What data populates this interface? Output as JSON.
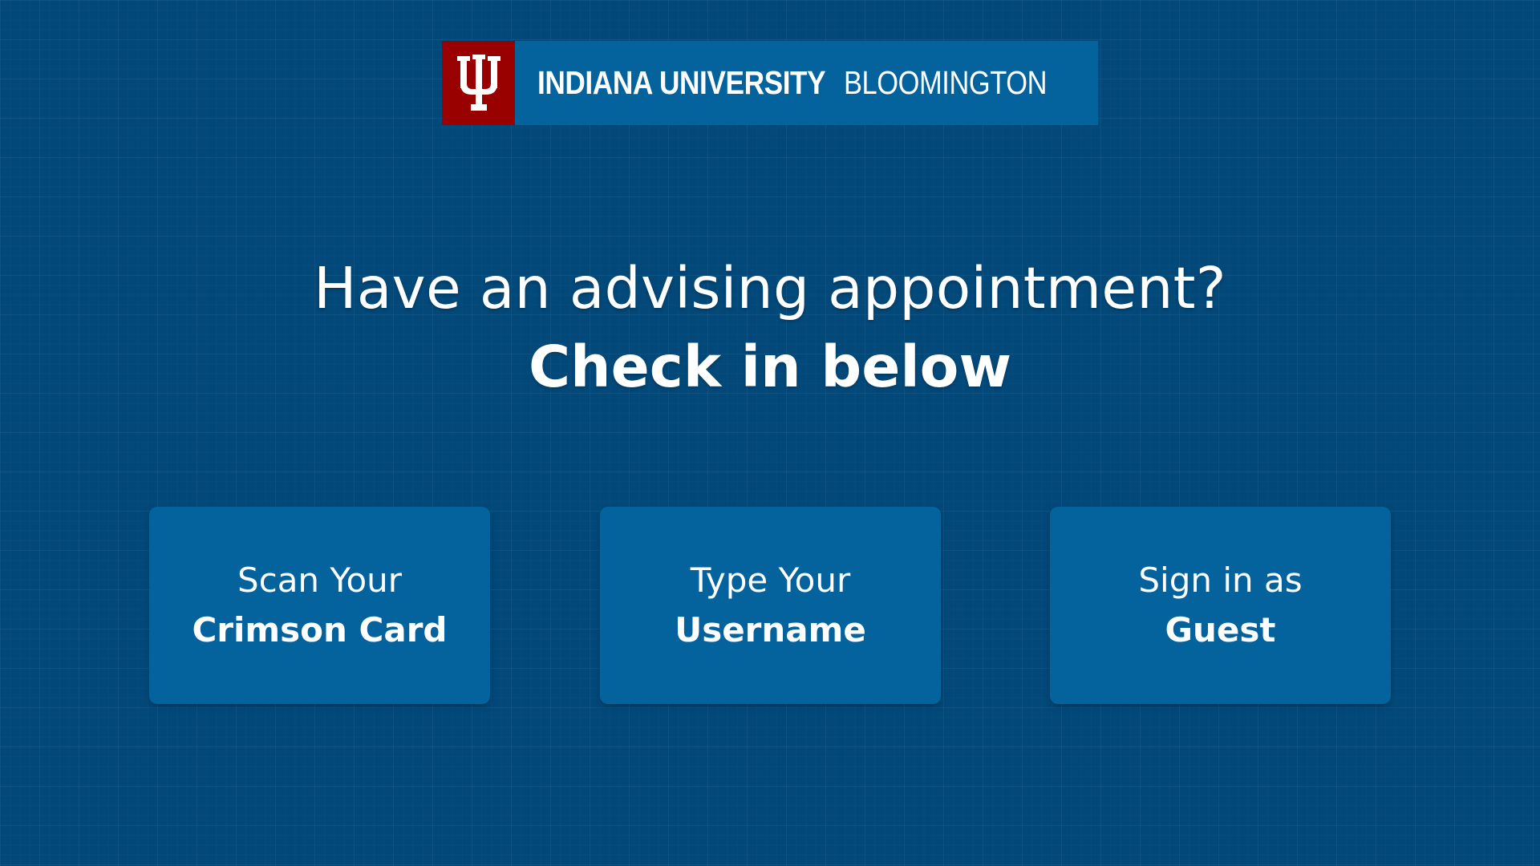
{
  "header": {
    "logo_icon": "iu-trident-icon",
    "brand_bold": "INDIANA UNIVERSITY",
    "brand_light": "BLOOMINGTON",
    "colors": {
      "crimson": "#990000",
      "bar": "#04629d"
    }
  },
  "main": {
    "heading": "Have an advising appointment?",
    "subheading": "Check in below"
  },
  "options": [
    {
      "line1": "Scan Your",
      "line2": "Crimson Card"
    },
    {
      "line1": "Type Your",
      "line2": "Username"
    },
    {
      "line1": "Sign in as",
      "line2": "Guest"
    }
  ],
  "colors": {
    "background": "#02497a",
    "button": "#04629d",
    "text": "#ffffff"
  }
}
